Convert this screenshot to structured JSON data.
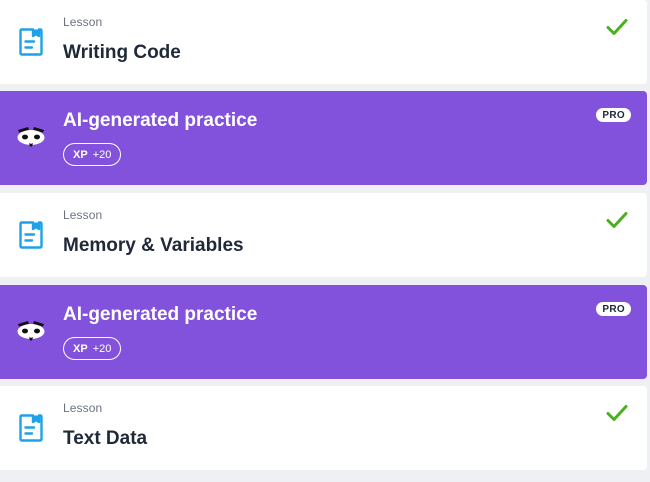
{
  "colors": {
    "practice_bg": "#8352dd",
    "lesson_bg": "#ffffff",
    "check_green": "#4caf1f",
    "doc_icon_blue": "#1da1e8"
  },
  "items": [
    {
      "type": "lesson",
      "kicker": "Lesson",
      "title": "Writing Code",
      "icon": "document-icon",
      "status_icon": "check-icon"
    },
    {
      "type": "practice",
      "title": "AI-generated practice",
      "xp_label": "XP",
      "xp_value": "+20",
      "badge": "PRO",
      "icon": "ai-bot-icon"
    },
    {
      "type": "lesson",
      "kicker": "Lesson",
      "title": "Memory & Variables",
      "icon": "document-icon",
      "status_icon": "check-icon"
    },
    {
      "type": "practice",
      "title": "AI-generated practice",
      "xp_label": "XP",
      "xp_value": "+20",
      "badge": "PRO",
      "icon": "ai-bot-icon"
    },
    {
      "type": "lesson",
      "kicker": "Lesson",
      "title": "Text Data",
      "icon": "document-icon",
      "status_icon": "check-icon"
    }
  ]
}
